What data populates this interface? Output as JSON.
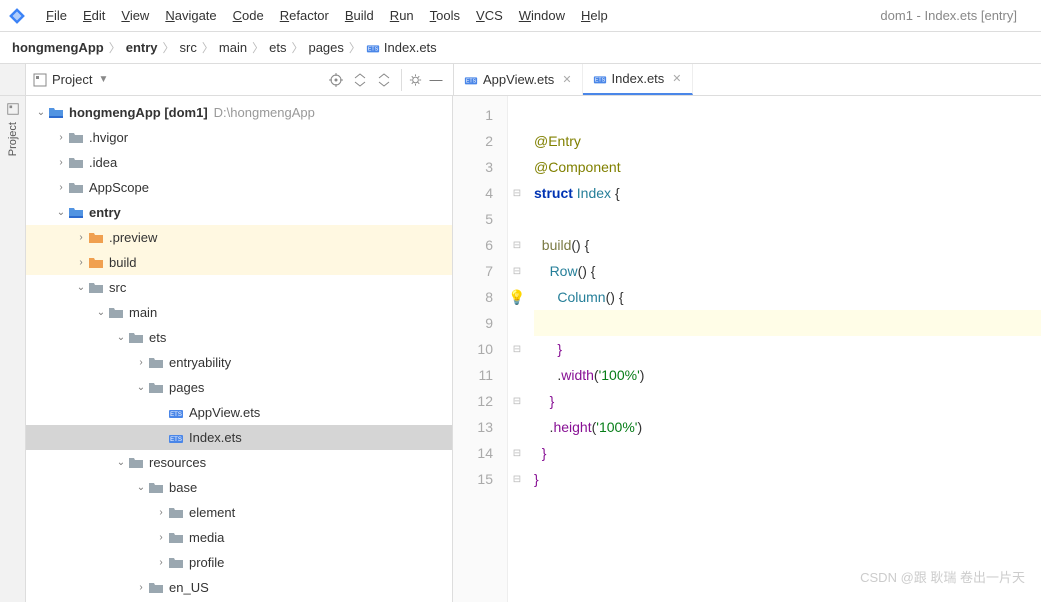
{
  "window_title": "dom1 - Index.ets [entry]",
  "menu": [
    "File",
    "Edit",
    "View",
    "Navigate",
    "Code",
    "Refactor",
    "Build",
    "Run",
    "Tools",
    "VCS",
    "Window",
    "Help"
  ],
  "breadcrumb": [
    {
      "label": "hongmengApp",
      "bold": true
    },
    {
      "label": "entry",
      "bold": true
    },
    {
      "label": "src"
    },
    {
      "label": "main"
    },
    {
      "label": "ets"
    },
    {
      "label": "pages"
    },
    {
      "label": "Index.ets",
      "icon": "ets"
    }
  ],
  "project_panel": {
    "title": "Project"
  },
  "side_tab": "Project",
  "tabs": [
    {
      "label": "AppView.ets",
      "active": false
    },
    {
      "label": "Index.ets",
      "active": true
    }
  ],
  "tree": [
    {
      "d": 0,
      "e": "v",
      "i": "mod",
      "l": "hongmengApp",
      "b": true,
      "suffix": "[dom1]",
      "hint": "D:\\hongmengApp"
    },
    {
      "d": 1,
      "e": ">",
      "i": "fold",
      "l": ".hvigor"
    },
    {
      "d": 1,
      "e": ">",
      "i": "fold",
      "l": ".idea"
    },
    {
      "d": 1,
      "e": ">",
      "i": "fold",
      "l": "AppScope"
    },
    {
      "d": 1,
      "e": "v",
      "i": "mod",
      "l": "entry",
      "b": true
    },
    {
      "d": 2,
      "e": ">",
      "i": "foldo",
      "l": ".preview",
      "hl": true
    },
    {
      "d": 2,
      "e": ">",
      "i": "foldo",
      "l": "build",
      "hl": true
    },
    {
      "d": 2,
      "e": "v",
      "i": "fold",
      "l": "src"
    },
    {
      "d": 3,
      "e": "v",
      "i": "fold",
      "l": "main"
    },
    {
      "d": 4,
      "e": "v",
      "i": "fold",
      "l": "ets"
    },
    {
      "d": 5,
      "e": ">",
      "i": "fold",
      "l": "entryability"
    },
    {
      "d": 5,
      "e": "v",
      "i": "fold",
      "l": "pages"
    },
    {
      "d": 6,
      "e": "",
      "i": "ets",
      "l": "AppView.ets"
    },
    {
      "d": 6,
      "e": "",
      "i": "ets",
      "l": "Index.ets",
      "sel": true
    },
    {
      "d": 4,
      "e": "v",
      "i": "fold",
      "l": "resources"
    },
    {
      "d": 5,
      "e": "v",
      "i": "fold",
      "l": "base"
    },
    {
      "d": 6,
      "e": ">",
      "i": "fold",
      "l": "element"
    },
    {
      "d": 6,
      "e": ">",
      "i": "fold",
      "l": "media"
    },
    {
      "d": 6,
      "e": ">",
      "i": "fold",
      "l": "profile"
    },
    {
      "d": 5,
      "e": ">",
      "i": "fold",
      "l": "en_US"
    }
  ],
  "code": {
    "lines": [
      [
        {
          "t": ""
        }
      ],
      [
        {
          "t": "@Entry",
          "c": "k-anno"
        }
      ],
      [
        {
          "t": "@Component",
          "c": "k-anno"
        }
      ],
      [
        {
          "t": "struct ",
          "c": "k-kw"
        },
        {
          "t": "Index ",
          "c": "k-type"
        },
        {
          "t": "{",
          "c": "k-brace"
        }
      ],
      [
        {
          "t": ""
        }
      ],
      [
        {
          "t": "  "
        },
        {
          "t": "build",
          "c": "k-fn"
        },
        {
          "t": "() ",
          "c": ""
        },
        {
          "t": "{",
          "c": "k-brace"
        }
      ],
      [
        {
          "t": "    "
        },
        {
          "t": "Row",
          "c": "k-type"
        },
        {
          "t": "() ",
          "c": ""
        },
        {
          "t": "{",
          "c": "k-brace"
        }
      ],
      [
        {
          "t": "      "
        },
        {
          "t": "Column",
          "c": "k-type"
        },
        {
          "t": "() ",
          "c": ""
        },
        {
          "t": "{",
          "c": "k-brace"
        }
      ],
      [
        {
          "t": ""
        }
      ],
      [
        {
          "t": "      "
        },
        {
          "t": "}",
          "c": "k-pbrace"
        }
      ],
      [
        {
          "t": "      ."
        },
        {
          "t": "width",
          "c": "k-prop"
        },
        {
          "t": "("
        },
        {
          "t": "'100%'",
          "c": "k-str"
        },
        {
          "t": ")"
        }
      ],
      [
        {
          "t": "    "
        },
        {
          "t": "}",
          "c": "k-pbrace"
        }
      ],
      [
        {
          "t": "    ."
        },
        {
          "t": "height",
          "c": "k-prop"
        },
        {
          "t": "("
        },
        {
          "t": "'100%'",
          "c": "k-str"
        },
        {
          "t": ")"
        }
      ],
      [
        {
          "t": "  "
        },
        {
          "t": "}",
          "c": "k-pbrace"
        }
      ],
      [
        {
          "t": "}",
          "c": "k-pbrace"
        }
      ]
    ],
    "current_line": 9,
    "bulb_line": 8
  },
  "watermark": "CSDN @跟 耿瑞 卷出一片天"
}
